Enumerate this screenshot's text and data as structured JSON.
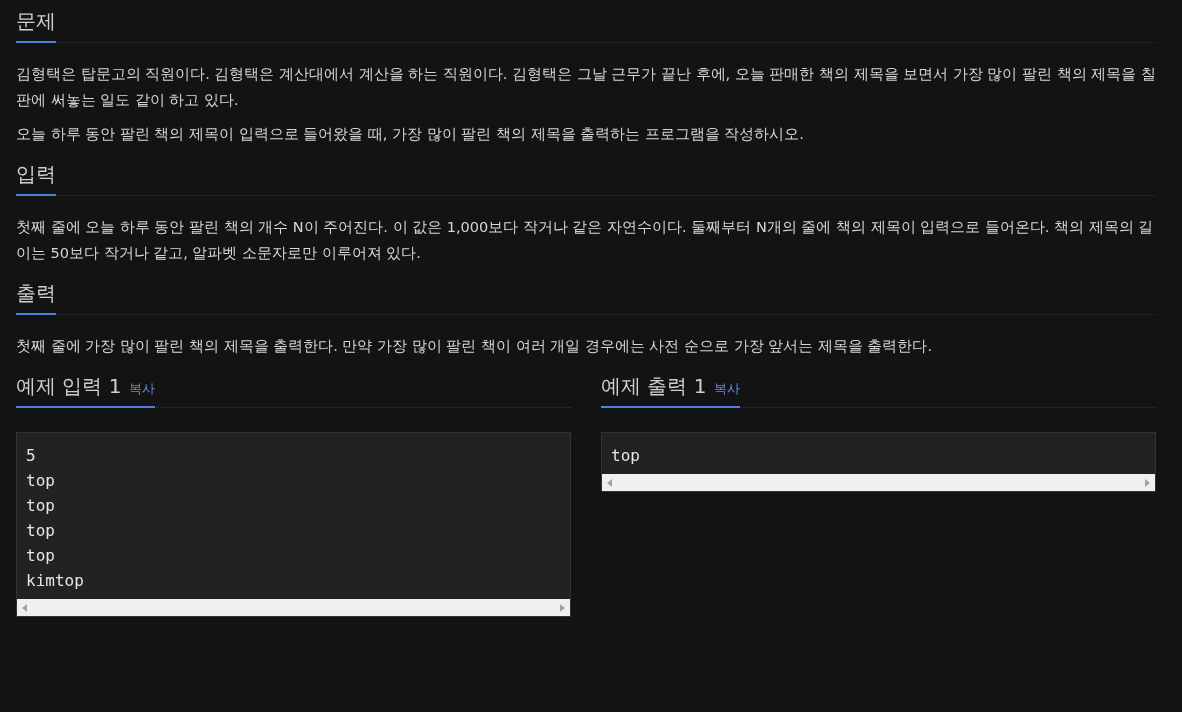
{
  "sections": [
    {
      "title": "문제",
      "paragraphs": [
        "김형택은 탑문고의 직원이다. 김형택은 계산대에서 계산을 하는 직원이다. 김형택은 그날 근무가 끝난 후에, 오늘 판매한 책의 제목을 보면서 가장 많이 팔린 책의 제목을 칠판에 써놓는 일도 같이 하고 있다.",
        "오늘 하루 동안 팔린 책의 제목이 입력으로 들어왔을 때, 가장 많이 팔린 책의 제목을 출력하는 프로그램을 작성하시오."
      ]
    },
    {
      "title": "입력",
      "paragraphs": [
        "첫째 줄에 오늘 하루 동안 팔린 책의 개수 N이 주어진다. 이 값은 1,000보다 작거나 같은 자연수이다. 둘째부터 N개의 줄에 책의 제목이 입력으로 들어온다. 책의 제목의 길이는 50보다 작거나 같고, 알파벳 소문자로만 이루어져 있다."
      ]
    },
    {
      "title": "출력",
      "paragraphs": [
        "첫째 줄에 가장 많이 팔린 책의 제목을 출력한다. 만약 가장 많이 팔린 책이 여러 개일 경우에는 사전 순으로 가장 앞서는 제목을 출력한다."
      ]
    }
  ],
  "samples": [
    {
      "title": "예제 입력 1",
      "copy": "복사",
      "lines": [
        "5",
        "top",
        "top",
        "top",
        "top",
        "kimtop"
      ]
    },
    {
      "title": "예제 출력 1",
      "copy": "복사",
      "lines": [
        "top"
      ]
    }
  ]
}
